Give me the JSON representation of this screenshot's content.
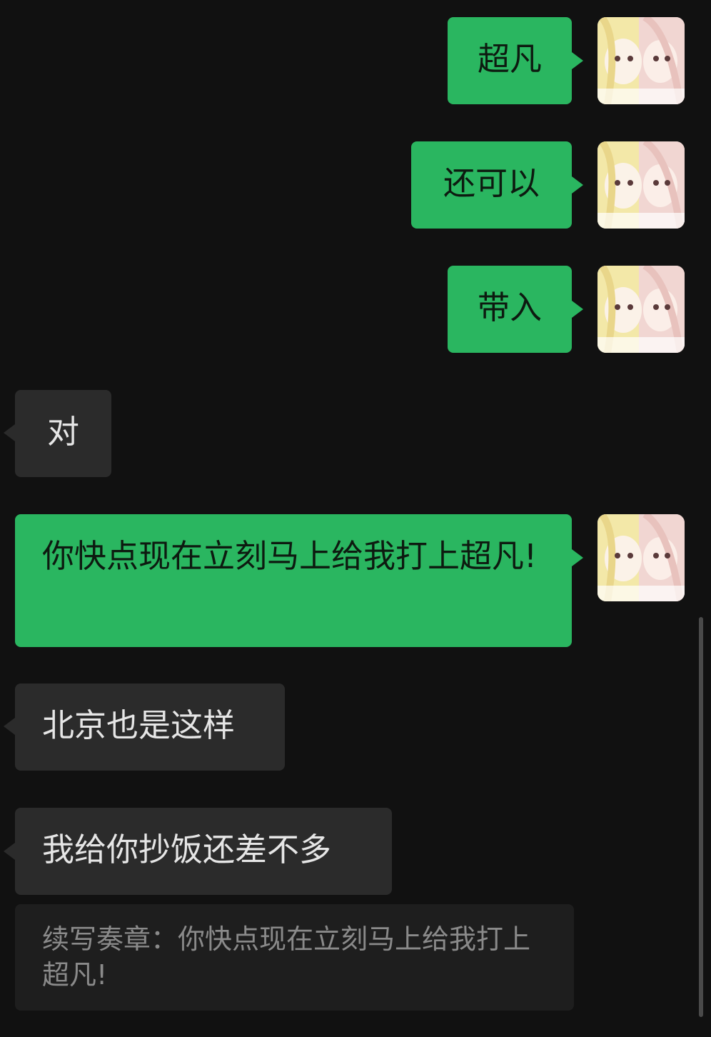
{
  "messages": [
    {
      "direction": "out",
      "text": "超凡"
    },
    {
      "direction": "out",
      "text": "还可以"
    },
    {
      "direction": "out",
      "text": "带入"
    },
    {
      "direction": "in",
      "text": "对"
    },
    {
      "direction": "out",
      "text": "你快点现在立刻马上给我打上超凡!"
    },
    {
      "direction": "in",
      "text": "北京也是这样"
    },
    {
      "direction": "in",
      "text": "我给你抄饭还差不多"
    }
  ],
  "quote": {
    "text": "续写奏章：你快点现在立刻马上给我打上超凡!"
  },
  "colors": {
    "background": "#111111",
    "outgoing_bubble": "#2ab660",
    "incoming_bubble": "#2b2b2b",
    "quote_bubble": "#1e1e1e"
  },
  "icons": {
    "avatar": "anime-girls-avatar"
  }
}
